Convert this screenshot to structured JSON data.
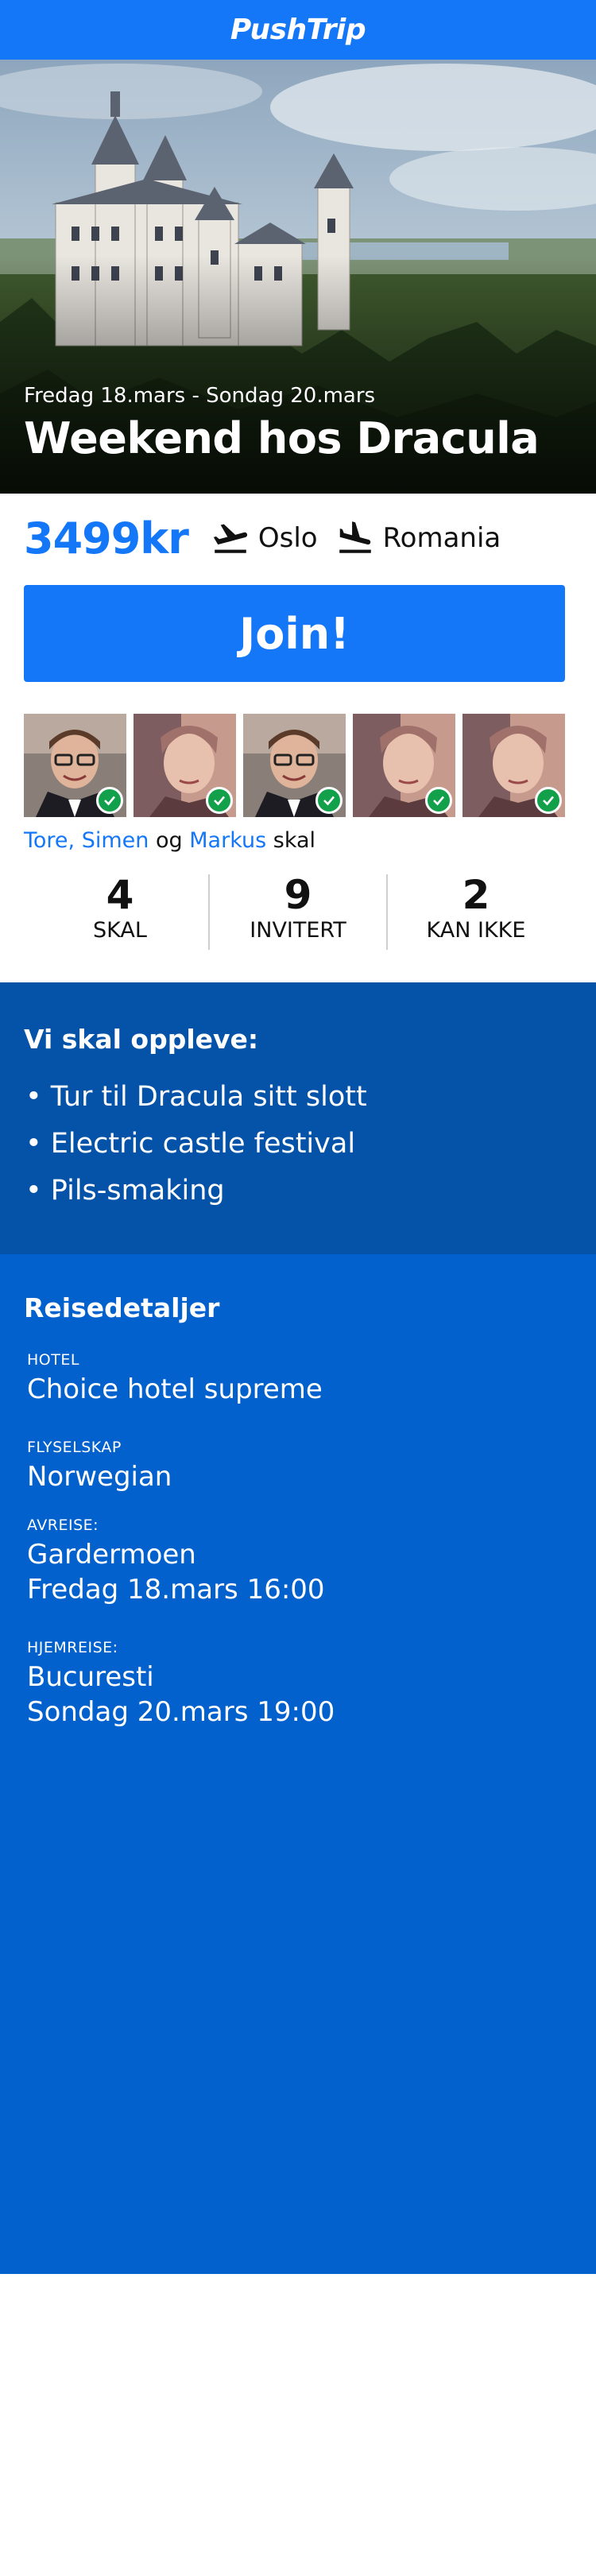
{
  "app": {
    "brand": "PushTrip"
  },
  "trip": {
    "dates": "Fredag 18.mars - Sondag 20.mars",
    "title": "Weekend hos Dracula",
    "price": "3499kr",
    "from": "Oslo",
    "to": "Romania",
    "join_label": "Join!"
  },
  "participants": {
    "avatars": [
      "participant-1",
      "participant-2",
      "participant-3",
      "participant-4",
      "participant-5"
    ],
    "going_names_1": "Tore,",
    "going_names_2": "Simen",
    "going_og": "og",
    "going_names_3": "Markus",
    "going_suffix": "skal"
  },
  "stats": [
    {
      "num": "4",
      "label": "SKAL"
    },
    {
      "num": "9",
      "label": "INVITERT"
    },
    {
      "num": "2",
      "label": "KAN IKKE"
    }
  ],
  "experience": {
    "title": "Vi skal oppleve:",
    "items": [
      "• Tur til Dracula sitt slott",
      "• Electric castle festival",
      "• Pils-smaking"
    ]
  },
  "details": {
    "title": "Reisedetaljer",
    "hotel": {
      "label": "HOTEL",
      "value": "Choice hotel supreme"
    },
    "airline": {
      "label": "FLYSELSKAP",
      "value": "Norwegian"
    },
    "departure": {
      "label": "AVREISE:",
      "line1": "Gardermoen",
      "line2": "Fredag 18.mars 16:00"
    },
    "return": {
      "label": "HJEMREISE:",
      "line1": "Bucuresti",
      "line2": "Sondag 20.mars 19:00"
    }
  },
  "colors": {
    "accent": "#1477f8",
    "experience_bg": "#0553a8",
    "details_bg": "#0261cc",
    "check": "#13a04a"
  },
  "icons": {
    "departure": "plane-departure-icon",
    "arrival": "plane-arrival-icon",
    "going": "check-icon"
  }
}
